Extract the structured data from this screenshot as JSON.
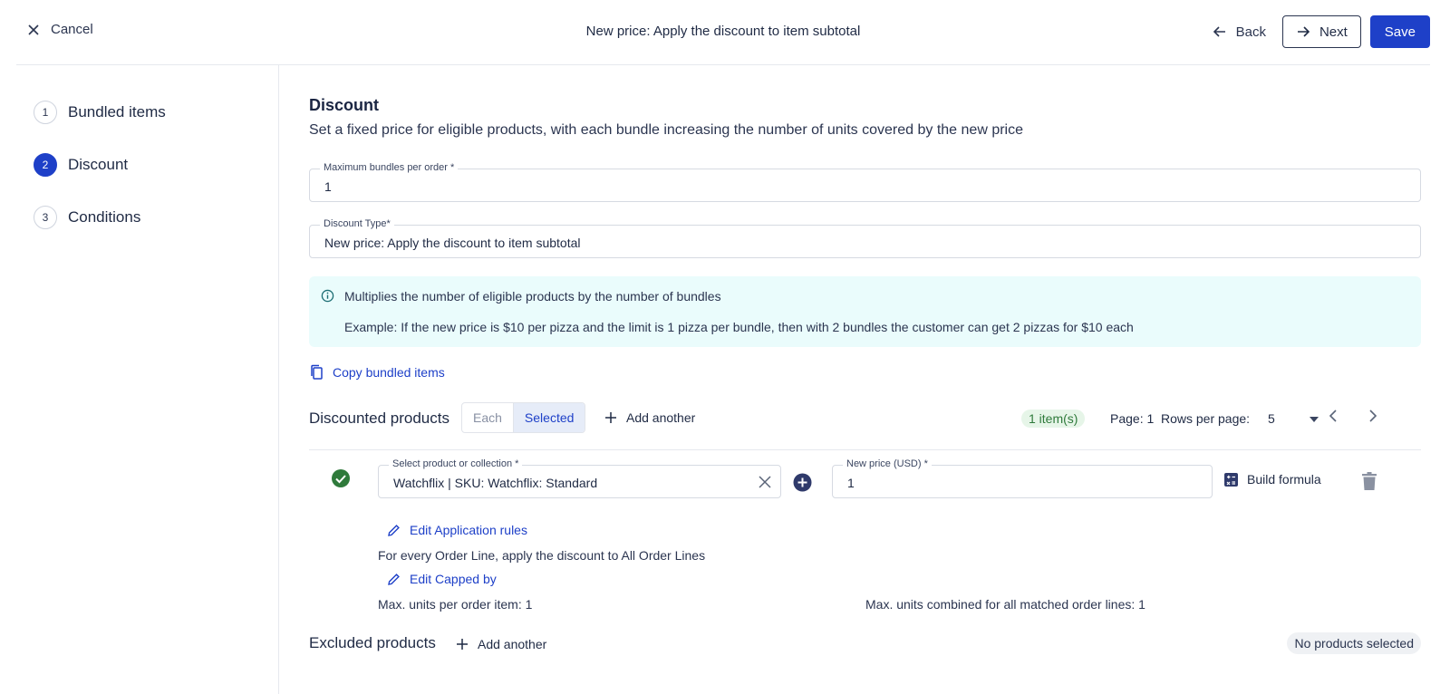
{
  "header": {
    "cancel_label": "Cancel",
    "title": "New price: Apply the discount to item subtotal",
    "back_label": "Back",
    "next_label": "Next",
    "save_label": "Save"
  },
  "sidebar": {
    "steps": [
      {
        "number": "1",
        "label": "Bundled items",
        "active": false
      },
      {
        "number": "2",
        "label": "Discount",
        "active": true
      },
      {
        "number": "3",
        "label": "Conditions",
        "active": false
      }
    ]
  },
  "discount": {
    "title": "Discount",
    "description": "Set a fixed price for eligible products, with each bundle increasing the number of units covered by the new price",
    "max_bundles": {
      "label": "Maximum bundles per order *",
      "value": "1"
    },
    "discount_type": {
      "label": "Discount Type*",
      "value": "New price: Apply the discount to item subtotal"
    },
    "info": {
      "line1": "Multiplies the number of eligible products by the number of bundles",
      "line2": "Example: If the new price is $10 per pizza and the limit is 1 pizza per bundle, then with 2 bundles the customer can get 2 pizzas for $10 each"
    },
    "copy_label": "Copy bundled items"
  },
  "discounted_products": {
    "label": "Discounted products",
    "toggle": {
      "each": "Each",
      "selected": "Selected",
      "active": "Selected"
    },
    "add_another": "Add another",
    "badge": "1 item(s)",
    "page": "Page: 1",
    "rows_label": "Rows per page:",
    "rows_value": "5",
    "item": {
      "product_label": "Select product or collection *",
      "product_value": "Watchflix | SKU: Watchflix: Standard",
      "price_label": "New price (USD) *",
      "price_value": "1",
      "build_formula": "Build formula",
      "edit_application_rules": "Edit Application rules",
      "application_text": "For every Order Line, apply the discount to All Order Lines",
      "edit_capped_by": "Edit Capped by",
      "max_units_item": "Max. units per order item: 1",
      "max_units_combined": "Max. units combined for all matched order lines: 1"
    }
  },
  "excluded_products": {
    "label": "Excluded products",
    "add_another": "Add another",
    "status": "No products selected"
  },
  "colors": {
    "accent": "#1e40c8",
    "info_bg": "#eafcfc",
    "success": "#2f7a3b"
  }
}
